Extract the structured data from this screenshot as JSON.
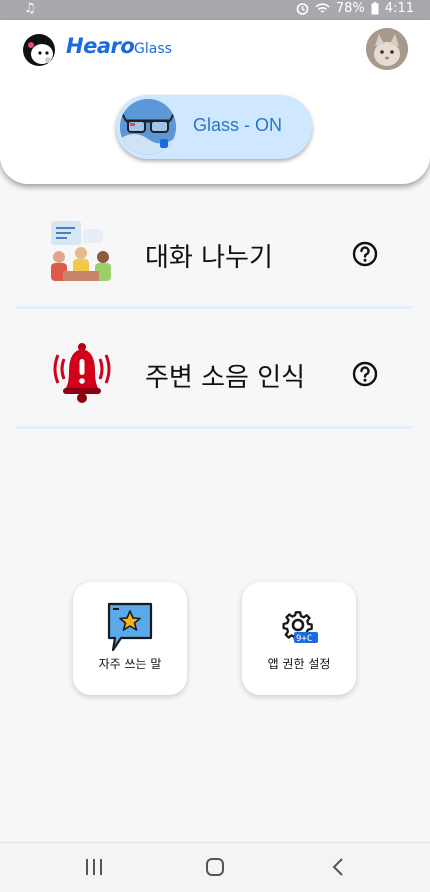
{
  "status_bar": {
    "left_icon": "music-note-icon",
    "icons": [
      "alarm-icon",
      "wifi-icon"
    ],
    "battery": "78%",
    "time": "4:11"
  },
  "header": {
    "logo_text": "Hearo",
    "logo_sub": "Glass",
    "mascot_icon": "mascot-icon",
    "avatar_icon": "cat-avatar"
  },
  "glass_toggle": {
    "label": "Glass - ON",
    "icon": "smart-glasses-icon",
    "bg_color": "#cfe8ff",
    "text_color": "#2a76c6"
  },
  "menu": [
    {
      "label": "대화 나누기",
      "icon": "conversation-illustration",
      "help_icon": "help-circle-icon"
    },
    {
      "label": "주변 소음 인식",
      "icon": "alarm-bell-icon",
      "help_icon": "help-circle-icon"
    }
  ],
  "tiles": [
    {
      "label": "자주 쓰는 말",
      "icon": "star-chat-icon"
    },
    {
      "label": "앱 권한 설정",
      "icon": "settings-gear-icon"
    }
  ],
  "nav": {
    "recents": "recents-icon",
    "home": "home-icon",
    "back": "back-icon"
  },
  "colors": {
    "brand": "#1b6be0",
    "divider": "#e4eef8"
  }
}
